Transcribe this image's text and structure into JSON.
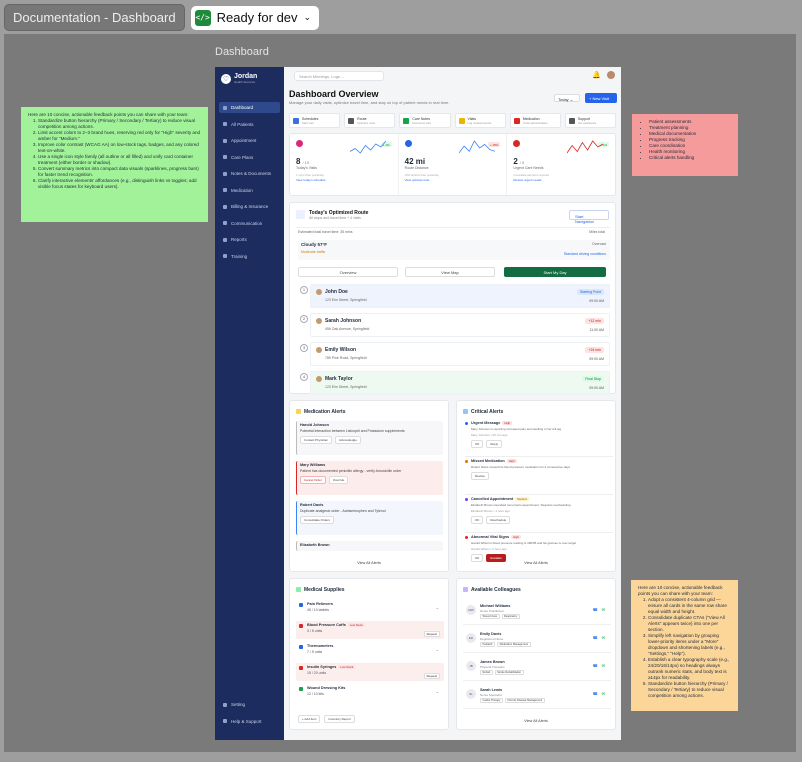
{
  "topbar": {
    "doc_title": "Documentation - Dashboard",
    "status": "Ready for dev",
    "status_icon": "code-icon"
  },
  "frame_label": "Dashboard",
  "brand": {
    "name": "Jordan",
    "sub": "Health Services"
  },
  "sidebar": {
    "items": [
      {
        "label": "Dashboard"
      },
      {
        "label": "All Patients"
      },
      {
        "label": "Appointment"
      },
      {
        "label": "Care Plans"
      },
      {
        "label": "Notes & Documents"
      },
      {
        "label": "Medication"
      },
      {
        "label": "Billing & Insurance"
      },
      {
        "label": "Communication"
      },
      {
        "label": "Reports"
      },
      {
        "label": "Training"
      }
    ],
    "bottom": [
      {
        "label": "Setting"
      },
      {
        "label": "Help & Support"
      }
    ]
  },
  "header": {
    "search_placeholder": "Search Meetings, Logs ..."
  },
  "page": {
    "title": "Dashboard Overview",
    "subtitle": "Manage your daily visits, optimize travel time, and stay on top of patient needs in real time.",
    "today_label": "Today",
    "new_visit_label": "+ New Visit"
  },
  "quick": [
    {
      "title": "Schedules",
      "sub": "Start visit",
      "color": "#3b6fe0"
    },
    {
      "title": "Route",
      "sub": "Optimize route",
      "color": "#555"
    },
    {
      "title": "Care Notes",
      "sub": "Document visit",
      "color": "#16a34a"
    },
    {
      "title": "Vitals",
      "sub": "Log measurements",
      "color": "#eab308"
    },
    {
      "title": "Medication",
      "sub": "Track administration",
      "color": "#dc2626"
    },
    {
      "title": "Support",
      "sub": "Get assistance",
      "color": "#555"
    }
  ],
  "stats": [
    {
      "value": "8",
      "total": "/ 15",
      "label": "Today's Visits",
      "small": "1 more than yesterday",
      "link": "View today's schedule",
      "badge": "+ 1%",
      "color": "#db2777",
      "line": "#3b82f6",
      "spark": [
        6,
        8,
        5,
        10,
        7,
        11,
        9,
        13
      ]
    },
    {
      "value": "42 mi",
      "label": "Route Distance",
      "small": "15% shorter than yesterday",
      "link": "View optimal route",
      "badge": "+ 15%",
      "color": "#2563eb",
      "line": "#3b82f6",
      "spark": [
        5,
        9,
        6,
        12,
        8,
        10,
        7,
        6
      ]
    },
    {
      "value": "2",
      "total": "/ 5",
      "label": "Urgent Care Needs",
      "small": "Immediate attention required",
      "link": "Review urgent needs",
      "badge": "+ 1%",
      "color": "#dc2626",
      "line": "#dc2626",
      "spark": [
        4,
        9,
        5,
        11,
        6,
        12,
        8,
        10
      ]
    }
  ],
  "route": {
    "title": "Today's Optimized Route",
    "sub": "All stops and travel time + 4 visits",
    "start_nav": "Start Navigation",
    "est_time": "Estimated total travel time: 35 mins",
    "miles": "Miles total",
    "weather": "Cloudy 57°F",
    "traffic": "Moderate traffic",
    "overcast": "Overcast",
    "conditions": "Standard driving conditions",
    "segments": [
      "Overview",
      "View Map",
      "Start My Day"
    ],
    "stops": [
      {
        "num": "1",
        "name": "John Doe",
        "addr": "123 Elm Street, Springfield",
        "badge": "Starting Point",
        "time": "09:00 AM"
      },
      {
        "num": "2",
        "name": "Sarah Johnson",
        "addr": "456 Oak Avenue, Springfield",
        "badge": "+12 min",
        "time": "11:00 AM"
      },
      {
        "num": "3",
        "name": "Emily Wilson",
        "addr": "789 Pine Road, Springfield",
        "badge": "+24 min",
        "time": "09:00 AM"
      },
      {
        "num": "4",
        "name": "Mark Taylor",
        "addr": "123 Elm Street, Springfield",
        "badge": "Final Stop",
        "time": "09:00 AM"
      }
    ]
  },
  "medication": {
    "title": "Medication Alerts",
    "items": [
      {
        "name": "Harold Johnson",
        "desc": "Potential interaction between Lisinopril and Potassium supplements",
        "btns": [
          "Contact Physician",
          "Acknowledge"
        ]
      },
      {
        "name": "Mary Williams",
        "desc": "Patient has documented penicillin allergy - verify Amoxicillin order",
        "btns": [
          "Cancel Order",
          "Override"
        ]
      },
      {
        "name": "Robert Davis",
        "desc": "Duplicate analgesic order - Acetaminophen and Tylenol",
        "btns": [
          "Consolidate Orders"
        ]
      },
      {
        "name": "Elizabeth Brown",
        "desc": "",
        "btns": []
      }
    ],
    "view_all": "View All Alerts"
  },
  "critical": {
    "title": "Critical Alerts",
    "items": [
      {
        "title": "Urgent Message",
        "badge": "High",
        "desc": "Mary Johnson is reporting increased pain and swelling in her left leg",
        "meta": "Mary Johnson  •  25 min ago",
        "btns": [
          "OK",
          "Reply"
        ]
      },
      {
        "title": "Missed Medication",
        "badge": "High",
        "desc": "Robert Davis missed his blood pressure medication for 2 consecutive days",
        "meta": "",
        "btns": [
          "Review"
        ]
      },
      {
        "title": "Cancelled Appointment",
        "badge": "Medium",
        "desc": "Elizabeth Brown cancelled tomorrow's appointment. Requires rescheduling.",
        "meta": "Elizabeth Brown  •  1 hour ago",
        "btns": [
          "OK",
          "Reschedule"
        ]
      },
      {
        "title": "Abnormal Vital Signs",
        "badge": "High",
        "desc": "Harold Wilson's blood pressure reading is 180/95 and his glucose is over target",
        "meta": "Harold Wilson  •  2 hour ago",
        "btns": [
          "OK",
          "Escalate"
        ]
      }
    ],
    "view_all": "View All Alerts"
  },
  "supplies": {
    "title": "Medical Supplies",
    "items": [
      {
        "name": "Pain Relievers",
        "count": "45 / 10 tablets",
        "low": "",
        "req": "",
        "color": "#2563eb"
      },
      {
        "name": "Blood Pressure Cuffs",
        "count": "3 / 5 units",
        "low": "Low Stock",
        "req": "Request",
        "color": "#dc2626"
      },
      {
        "name": "Thermometers",
        "count": "7 / 5 units",
        "low": "",
        "req": "",
        "color": "#2563eb"
      },
      {
        "name": "Insulin Syringes",
        "count": "15 / 20 units",
        "low": "Low Stock",
        "req": "Request",
        "color": "#dc2626"
      },
      {
        "name": "Wound Dressing Kits",
        "count": "12 / 10 kits",
        "low": "",
        "req": "",
        "color": "#16a34a"
      }
    ],
    "add_item": "+ Add Item",
    "inventory": "Inventory Report"
  },
  "colleagues": {
    "title": "Available Colleagues",
    "items": [
      {
        "initials": "MW",
        "name": "Michael Williams",
        "role": "Nurse Practitioner",
        "tags": [
          "Wound Care",
          "Respiratory"
        ]
      },
      {
        "initials": "ED",
        "name": "Emily Davis",
        "role": "Registered Nurse",
        "tags": [
          "Pediatric",
          "Medication Management"
        ]
      },
      {
        "initials": "JB",
        "name": "James Brown",
        "role": "Physical Therapist",
        "tags": [
          "Rehab",
          "Stroke Rehabilitation"
        ]
      },
      {
        "initials": "SL",
        "name": "Sarah Lewis",
        "role": "Nurse Specialist",
        "tags": [
          "Cardio Therapy",
          "Chronic Disease Management"
        ]
      }
    ],
    "view_all": "View All Alerts"
  },
  "notes": {
    "green_intro": "Here are 10 concise, actionable feedback points you can share with your team:",
    "green": [
      "Standardize button hierarchy (Primary / Secondary / Tertiary) to reduce visual competition among actions.",
      "Limit accent colors to 2–3 brand hues, reserving red only for \"High\" severity and amber for \"Medium.\"",
      "Improve color contrast (WCAG AA) on low-stock tags, badges, and any colored text-on-white.",
      "Use a single icon style family (all outline or all filled) and unify card container treatment (either border or shadow).",
      "Convert summary metrics into compact data visuals (sparklines, progress bars) for faster trend recognition.",
      "Clarify interactive elements' affordances (e.g., distinguish links vs toggles; add visible focus states for keyboard users)."
    ],
    "pink": [
      "Patient assessments",
      "Treatment planning",
      "Medical documentation",
      "Progress tracking",
      "Care coordination",
      "Health monitoring",
      "Critical alerts handling"
    ],
    "yellow_intro": "Here are 10 concise, actionable feedback points you can share with your team:",
    "yellow": [
      "Adopt a consistent 4-column grid — ensure all cards in the same row share equal width and height.",
      "Consolidate duplicate CTAs (\"View All Alerts\" appears twice) into one per section.",
      "Simplify left navigation by grouping lower-priority items under a \"More\" dropdown and shortening labels (e.g., \"Settings,\" \"Help\").",
      "Establish a clear typography scale (e.g., 24/20/16/14px) so headings always outrank numeric stats, and body text is ≥14px for readability.",
      "Standardize button hierarchy (Primary / Secondary / Tertiary) to reduce visual competition among actions."
    ]
  }
}
